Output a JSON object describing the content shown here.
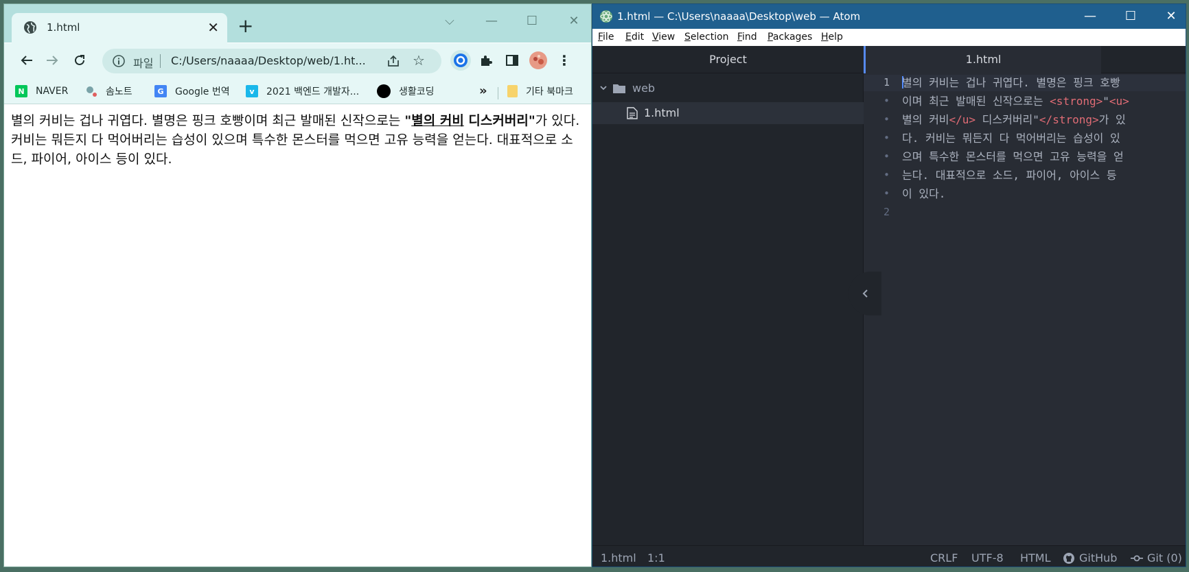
{
  "browser": {
    "tab_title": "1.html",
    "url_scheme_label": "파일",
    "url": "C:/Users/naaaa/Desktop/web/1.ht...",
    "bookmarks": [
      {
        "label": "NAVER",
        "icon": "naver-icon",
        "color": "#03c75a"
      },
      {
        "label": "솜노트",
        "icon": "somnote-icon",
        "color": "#7aa3a8"
      },
      {
        "label": "Google 번역",
        "icon": "google-translate-icon",
        "color": "#4285f4"
      },
      {
        "label": "2021 백엔드 개발자...",
        "icon": "vimeo-icon",
        "color": "#1ab7ea"
      },
      {
        "label": "생활코딩",
        "icon": "circle-icon",
        "color": "#000000"
      }
    ],
    "other_bookmarks": "기타 북마크",
    "content": {
      "before": "별의 커비는 겁나 귀엽다. 별명은 핑크 호빵이며 최근 발매된 신작으로는 ",
      "strong_open_quote": "\"",
      "underlined": "별의 커비",
      "strong_rest": " 디스커버리\"",
      "after": "가 있다. 커비는 뭐든지 다 먹어버리는 습성이 있으며 특수한 몬스터를 먹으면 고유 능력을 얻는다. 대표적으로 소드, 파이어, 아이스 등이 있다."
    }
  },
  "atom": {
    "window_title": "1.html — C:\\Users\\naaaa\\Desktop\\web — Atom",
    "menu": [
      {
        "label": "File",
        "key": "F",
        "rest": "ile"
      },
      {
        "label": "Edit",
        "key": "E",
        "rest": "dit"
      },
      {
        "label": "View",
        "key": "V",
        "rest": "iew"
      },
      {
        "label": "Selection",
        "key": "S",
        "rest": "election"
      },
      {
        "label": "Find",
        "key": "F",
        "rest": "ind"
      },
      {
        "label": "Packages",
        "key": "P",
        "rest": "ackages"
      },
      {
        "label": "Help",
        "key": "H",
        "rest": "elp"
      }
    ],
    "tree_title": "Project",
    "folder_name": "web",
    "file_name": "1.html",
    "editor_tab": "1.html",
    "line_numbers": [
      "1",
      "•",
      "•",
      "•",
      "•",
      "•",
      "•",
      "2"
    ],
    "code": {
      "l1": "별의 커비는 겁나 귀엽다. 별명은 핑크 호빵",
      "l2_text": "이며 최근 발매된 신작으로는 ",
      "strong_open": "<strong>",
      "quote": "\"",
      "u_open": "<u>",
      "l3_text": "별의 커비",
      "u_close": "</u>",
      "l3_mid": " 디스커버리\"",
      "strong_close": "</strong>",
      "l3_end": "가 있",
      "l4": "다. 커비는 뭐든지 다 먹어버리는 습성이 있",
      "l5": "으며 특수한 몬스터를 먹으면 고유 능력을 얻",
      "l6": "는다. 대표적으로 소드, 파이어, 아이스 등",
      "l7": "이 있다."
    },
    "status": {
      "file": "1.html",
      "cursor": "1:1",
      "line_ending": "CRLF",
      "encoding": "UTF-8",
      "grammar": "HTML",
      "github": "GitHub",
      "git": "Git (0)"
    }
  }
}
